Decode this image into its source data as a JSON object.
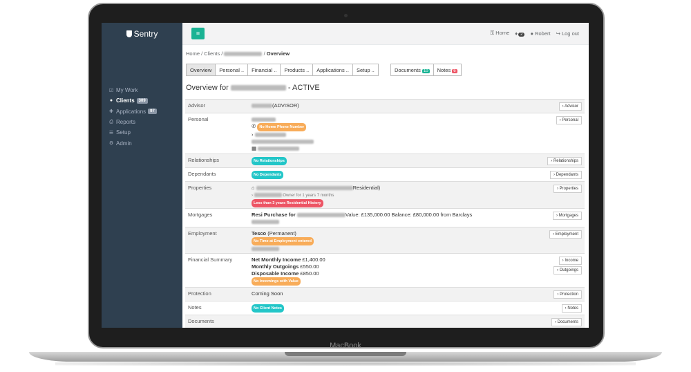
{
  "device": {
    "label": "MacBook"
  },
  "brand": {
    "name": "Sentry"
  },
  "sidebar": {
    "items": [
      {
        "icon": "check-icon",
        "label": "My Work",
        "badge": ""
      },
      {
        "icon": "users-icon",
        "label": "Clients",
        "badge": "309"
      },
      {
        "icon": "plus-icon",
        "label": "Applications",
        "badge": "97"
      },
      {
        "icon": "print-icon",
        "label": "Reports",
        "badge": ""
      },
      {
        "icon": "list-icon",
        "label": "Setup",
        "badge": ""
      },
      {
        "icon": "gear-icon",
        "label": "Admin",
        "badge": ""
      }
    ]
  },
  "topbar": {
    "home": "Home",
    "bell_count": "2",
    "user": "Robert",
    "logout": "Log out"
  },
  "breadcrumb": {
    "home": "Home",
    "clients": "Clients",
    "current": "Overview"
  },
  "tabs": [
    "Overview",
    "Personal ..",
    "Financial ..",
    "Products ..",
    "Applications ..",
    "Setup .."
  ],
  "tabs2": {
    "documents": "Documents",
    "documents_count": "10",
    "notes": "Notes",
    "notes_count": "6"
  },
  "page": {
    "title_prefix": "Overview for",
    "title_suffix": "- ACTIVE"
  },
  "rows": {
    "advisor": {
      "label": "Advisor",
      "suffix": "(ADVISOR)",
      "button": "Advisor"
    },
    "personal": {
      "label": "Personal",
      "pill": "No Home Phone Number",
      "button": "Personal"
    },
    "relationships": {
      "label": "Relationships",
      "pill": "No Relationships",
      "button": "Relationships"
    },
    "dependants": {
      "label": "Dependants",
      "pill": "No Dependants",
      "button": "Dependants"
    },
    "properties": {
      "label": "Properties",
      "suffix": "Residential)",
      "owner": "Owner for 1 years 7 months",
      "pill": "Less than 3 years Residential History",
      "button": "Properties"
    },
    "mortgages": {
      "label": "Mortgages",
      "prefix": "Resi Purchase for",
      "detail": "Value: £135,000.00 Balance: £80,000.00 from Barclays",
      "button": "Mortgages"
    },
    "employment": {
      "label": "Employment",
      "employer": "Tesco",
      "type": "(Permanent)",
      "pill": "No Time at Employment entered",
      "button": "Employment"
    },
    "financial": {
      "label": "Financial Summary",
      "income_label": "Net Monthly Income",
      "income": "£1,400.00",
      "outgoings_label": "Monthly Outgoings",
      "outgoings": "£550.00",
      "disposable_label": "Disposable Income",
      "disposable": "£850.00",
      "pill": "No Incomings with Value",
      "button_income": "Income",
      "button_outgoings": "Outgoings"
    },
    "protection": {
      "label": "Protection",
      "value": "Coming Soon",
      "button": "Protection"
    },
    "notes": {
      "label": "Notes",
      "pill": "No Client Notes",
      "button": "Notes"
    },
    "documents": {
      "label": "Documents",
      "button": "Documents"
    }
  }
}
